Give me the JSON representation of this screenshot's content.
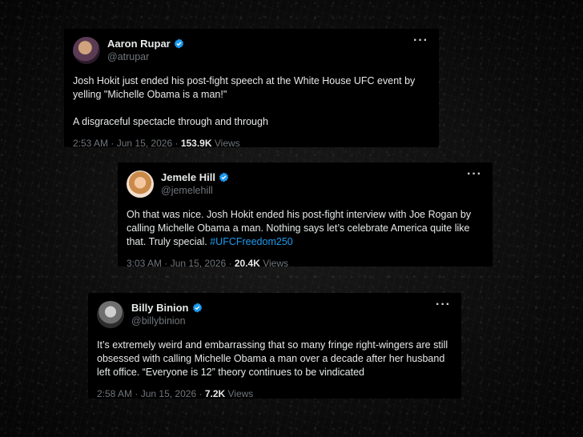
{
  "tweets": [
    {
      "name": "Aaron Rupar",
      "handle": "@atrupar",
      "more": "···",
      "text1": "Josh Hokit just ended his post-fight speech at the White House UFC event by yelling \"Michelle Obama is a man!\"",
      "text2": "A disgraceful spectacle through and through",
      "time": "2:53 AM",
      "date": "Jun 15, 2026",
      "views_count": "153.9K",
      "views_label": "Views"
    },
    {
      "name": "Jemele Hill",
      "handle": "@jemelehill",
      "more": "···",
      "text1": "Oh that was nice. Josh Hokit ended his post-fight interview with Joe Rogan by calling Michelle Obama a man. Nothing says let’s celebrate America quite like that. Truly special. ",
      "hashtag": "#UFCFreedom250",
      "time": "3:03 AM",
      "date": "Jun 15, 2026",
      "views_count": "20.4K",
      "views_label": "Views"
    },
    {
      "name": "Billy Binion",
      "handle": "@billybinion",
      "more": "···",
      "text1": "It’s extremely weird and embarrassing that so many fringe right-wingers are still obsessed with calling Michelle Obama a man over a decade after her husband left office. “Everyone is 12” theory continues to be vindicated",
      "time": "2:58 AM",
      "date": "Jun 15, 2026",
      "views_count": "7.2K",
      "views_label": "Views"
    }
  ],
  "separator": "·",
  "colors": {
    "verified": "#1d9bf0",
    "hashtag": "#1d9bf0",
    "muted": "#71767b"
  },
  "icons": {
    "verified": "verified-badge-icon",
    "more": "more-options-icon"
  }
}
